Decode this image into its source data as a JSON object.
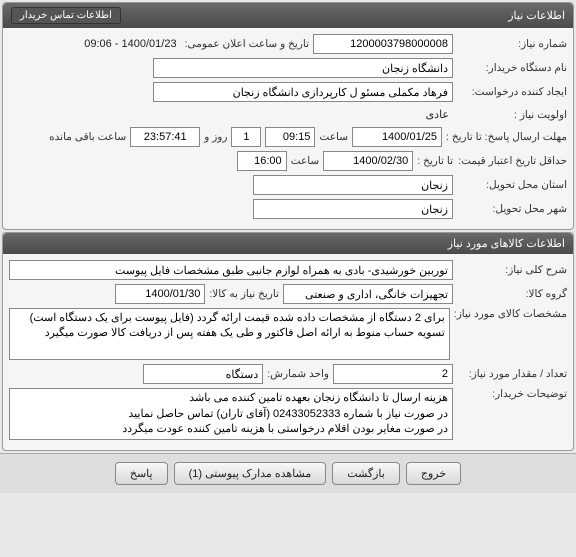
{
  "panels": {
    "need_info_title": "اطلاعات نیاز",
    "goods_info_title": "اطلاعات کالاهای مورد نیاز"
  },
  "header_link": "اطلاعات تماس خریدار",
  "labels": {
    "need_number": "شماره نیاز:",
    "announce_datetime": "تاریخ و ساعت اعلان عمومی:",
    "buyer_org": "نام دستگاه خریدار:",
    "requester": "ایجاد کننده درخواست:",
    "priority": "اولویت نیاز :",
    "deadline": "مهلت ارسال پاسخ:  تا تاریخ :",
    "time": "ساعت",
    "day_and": "روز و",
    "time_remain": "ساعت باقی مانده",
    "price_validity": "حداقل تاریخ اعتبار قیمت:",
    "to_date": "تا تاریخ :",
    "delivery_province": "استان محل تحویل:",
    "delivery_city": "شهر محل تحویل:",
    "general_desc": "شرح کلی نیاز:",
    "goods_group": "گروه کالا:",
    "need_goods_date": "تاریخ نیاز به کالا:",
    "goods_specs": "مشخصات کالای مورد نیاز:",
    "qty": "تعداد / مقدار مورد نیاز:",
    "unit": "واحد شمارش:",
    "buyer_notes": "توضیحات خریدار:"
  },
  "values": {
    "need_number": "1200003798000008",
    "announce_datetime": "1400/01/23 - 09:06",
    "buyer_org": "دانشگاه زنجان",
    "requester": "فرهاد مکملی مسئو ل کارپردازی دانشگاه زنجان",
    "priority": "عادی",
    "deadline_date": "1400/01/25",
    "deadline_time": "09:15",
    "days_remain": "1",
    "time_remain": "23:57:41",
    "price_validity_date": "1400/02/30",
    "price_validity_time": "16:00",
    "delivery_province": "زنجان",
    "delivery_city": "زنجان",
    "general_desc": "توربین خورشیدی- بادی به همراه لوازم جانبی طبق مشخصات فایل پیوست",
    "goods_group": "تجهیزات خانگی، اداری و صنعتی",
    "need_goods_date": "1400/01/30",
    "goods_specs": "برای 2 دستگاه از مشخصات داده شده قیمت ارائه گردد (فایل پیوست برای یک دستگاه است)\nتسویه حساب منوط به ارائه اصل فاکتور و طی یک هفته پس از دریافت کالا صورت میگیرد",
    "qty": "2",
    "unit": "دستگاه",
    "buyer_notes": "هزینه ارسال تا دانشگاه زنجان بعهده تامین کننده می باشد\nدر صورت نیاز با شماره 02433052333 (آقای تاران) تماس حاصل نمایید\nدر صورت مغایر بودن اقلام درخواستی با هزینه تامین کننده عودت میگردد"
  },
  "buttons": {
    "exit": "خروج",
    "back": "بازگشت",
    "attachments": "مشاهده مدارک پیوستی (1)",
    "respond": "پاسخ"
  }
}
